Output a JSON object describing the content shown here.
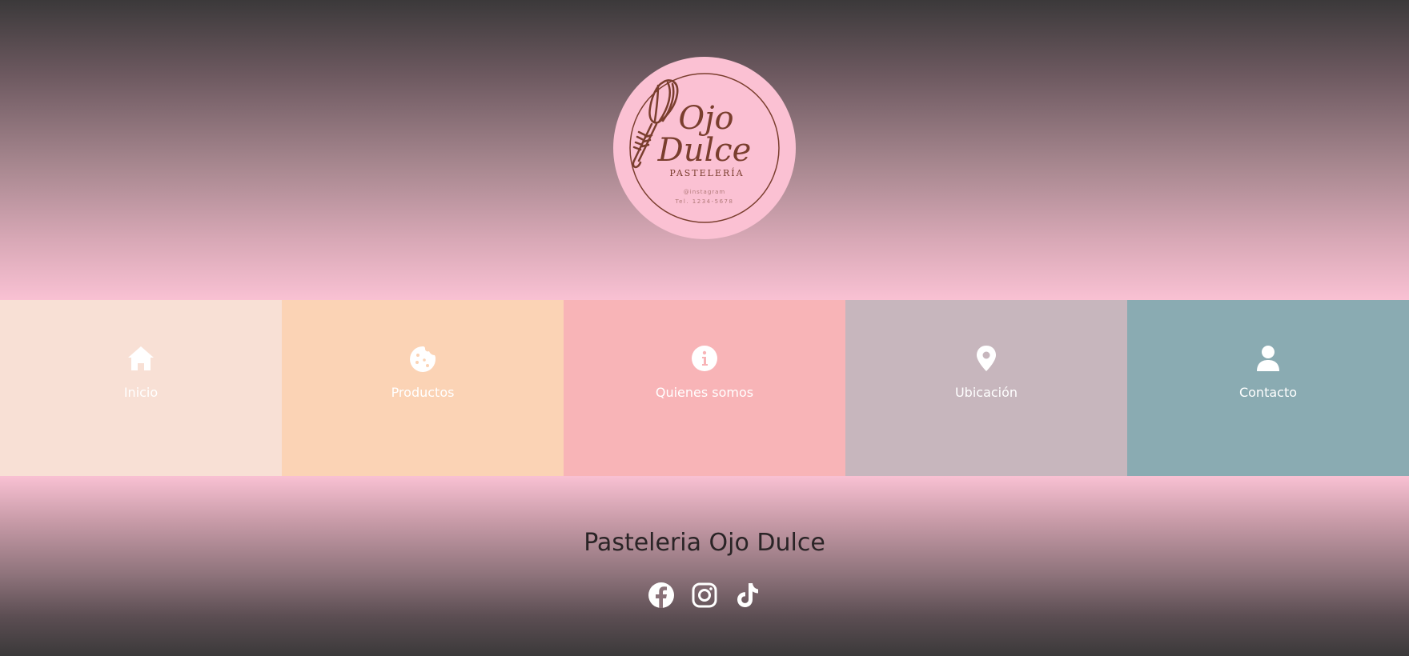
{
  "logo": {
    "title_line1": "Ojo",
    "title_line2": "Dulce",
    "subtitle": "PASTELERÍA",
    "instagram": "@instagram",
    "phone": "Tel. 1234-5678",
    "icon": "whisk-icon"
  },
  "nav": {
    "items": [
      {
        "label": "Inicio",
        "icon": "home-icon",
        "color": "#f8e0d5"
      },
      {
        "label": "Productos",
        "icon": "cookie-icon",
        "color": "#fbd3b5"
      },
      {
        "label": "Quienes somos",
        "icon": "info-icon",
        "color": "#f8b4b7"
      },
      {
        "label": "Ubicación",
        "icon": "location-pin-icon",
        "color": "#c7b6bd"
      },
      {
        "label": "Contacto",
        "icon": "user-icon",
        "color": "#8aabb2"
      }
    ]
  },
  "footer": {
    "title": "Pasteleria Ojo Dulce",
    "social": [
      {
        "icon": "facebook-icon"
      },
      {
        "icon": "instagram-icon"
      },
      {
        "icon": "tiktok-icon"
      }
    ]
  },
  "colors": {
    "logo_bg": "#fbc1d3",
    "logo_ink": "#7a3e2e",
    "header_top": "#3b393a",
    "header_bottom": "#f9c1d3"
  }
}
